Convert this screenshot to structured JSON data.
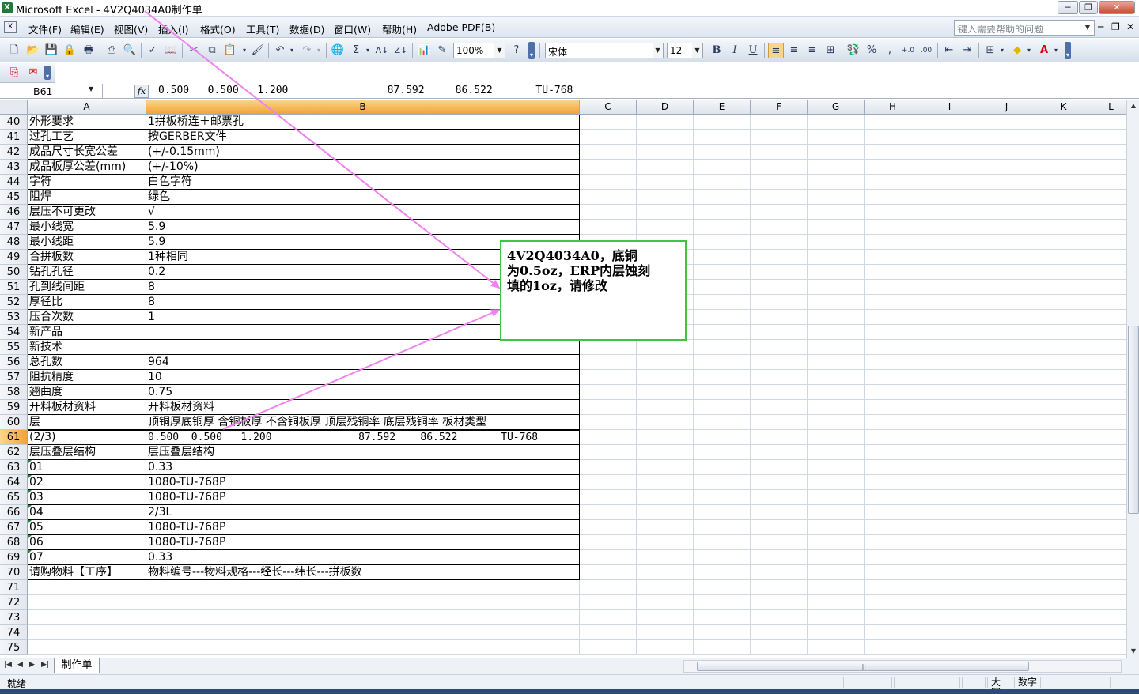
{
  "window": {
    "title": "Microsoft Excel - 4V2Q4034A0制作单",
    "app_icon": "excel-icon",
    "controls": [
      "─",
      "❐",
      "✕"
    ]
  },
  "menu": {
    "items": [
      "文件(F)",
      "编辑(E)",
      "视图(V)",
      "插入(I)",
      "格式(O)",
      "工具(T)",
      "数据(D)",
      "窗口(W)",
      "帮助(H)",
      "Adobe PDF(B)"
    ],
    "help_placeholder": "键入需要帮助的问题",
    "doc_controls": [
      "─",
      "❐",
      "✕"
    ]
  },
  "toolbar": {
    "zoom": "100%",
    "font_name": "宋体",
    "font_size": "12",
    "bold": "B",
    "italic": "I",
    "underline": "U",
    "percent": "%",
    "comma": ","
  },
  "formula_bar": {
    "name_box": "B61",
    "fx": "fx",
    "formula": "0.500   0.500   1.200                87.592     86.522       TU-768"
  },
  "grid": {
    "columns": [
      "A",
      "B",
      "C",
      "D",
      "E",
      "F",
      "G",
      "H",
      "I",
      "J",
      "K",
      "L"
    ],
    "active_column": "B",
    "active_row": "61",
    "rows": [
      {
        "n": "40",
        "a": "外形要求",
        "b": "1拼板桥连＋邮票孔"
      },
      {
        "n": "41",
        "a": "过孔工艺",
        "b": "按GERBER文件"
      },
      {
        "n": "42",
        "a": "成品尺寸长宽公差",
        "b": "(+/-0.15mm)"
      },
      {
        "n": "43",
        "a": "成品板厚公差(mm)",
        "b": "(+/-10%)"
      },
      {
        "n": "44",
        "a": "字符",
        "b": "白色字符"
      },
      {
        "n": "45",
        "a": "阻焊",
        "b": "绿色"
      },
      {
        "n": "46",
        "a": "层压不可更改",
        "b": "√"
      },
      {
        "n": "47",
        "a": "最小线宽",
        "b": "5.9"
      },
      {
        "n": "48",
        "a": "最小线距",
        "b": "5.9"
      },
      {
        "n": "49",
        "a": "合拼板数",
        "b": "1种相同"
      },
      {
        "n": "50",
        "a": "钻孔孔径",
        "b": "0.2"
      },
      {
        "n": "51",
        "a": "孔到线间距",
        "b": "8"
      },
      {
        "n": "52",
        "a": "厚径比",
        "b": "8"
      },
      {
        "n": "53",
        "a": "压合次数",
        "b": "1"
      },
      {
        "n": "54",
        "a": "新产品",
        "b": ""
      },
      {
        "n": "55",
        "a": "新技术",
        "b": ""
      },
      {
        "n": "56",
        "a": "总孔数",
        "b": "964"
      },
      {
        "n": "57",
        "a": "阻抗精度",
        "b": "10"
      },
      {
        "n": "58",
        "a": "翘曲度",
        "b": "0.75"
      },
      {
        "n": "59",
        "a": "开料板材资料",
        "b": "开料板材资料"
      },
      {
        "n": "60",
        "a": "层",
        "b": "顶铜厚底铜厚 含铜板厚 不含铜板厚 顶层残铜率 底层残铜率 板材类型"
      },
      {
        "n": "61",
        "a": "(2/3)",
        "b": "0.500  0.500   1.200              87.592    86.522       TU-768"
      },
      {
        "n": "62",
        "a": "层压叠层结构",
        "b": "层压叠层结构"
      },
      {
        "n": "63",
        "a": "01",
        "b": "0.33"
      },
      {
        "n": "64",
        "a": "02",
        "b": "1080-TU-768P"
      },
      {
        "n": "65",
        "a": "03",
        "b": "1080-TU-768P"
      },
      {
        "n": "66",
        "a": "04",
        "b": "2/3L"
      },
      {
        "n": "67",
        "a": "05",
        "b": "1080-TU-768P"
      },
      {
        "n": "68",
        "a": "06",
        "b": "1080-TU-768P"
      },
      {
        "n": "69",
        "a": "07",
        "b": "0.33"
      },
      {
        "n": "70",
        "a": "请购物料【工序】",
        "b": "物料编号---物料规格---经长---纬长---拼板数"
      },
      {
        "n": "71",
        "a": "",
        "b": ""
      },
      {
        "n": "72",
        "a": "",
        "b": ""
      },
      {
        "n": "73",
        "a": "",
        "b": ""
      },
      {
        "n": "74",
        "a": "",
        "b": ""
      },
      {
        "n": "75",
        "a": "",
        "b": ""
      }
    ]
  },
  "annotation": {
    "text": "4V2Q4034A0，底铜\n为0.5oz，ERP内层蚀刻\n填的1oz，请修改",
    "border_color": "#3ec43e",
    "arrow_color": "#ee82ee"
  },
  "sheets": {
    "tabs": [
      "制作单"
    ]
  },
  "status": {
    "ready": "就绪",
    "caps": "大写",
    "num": "数字"
  }
}
